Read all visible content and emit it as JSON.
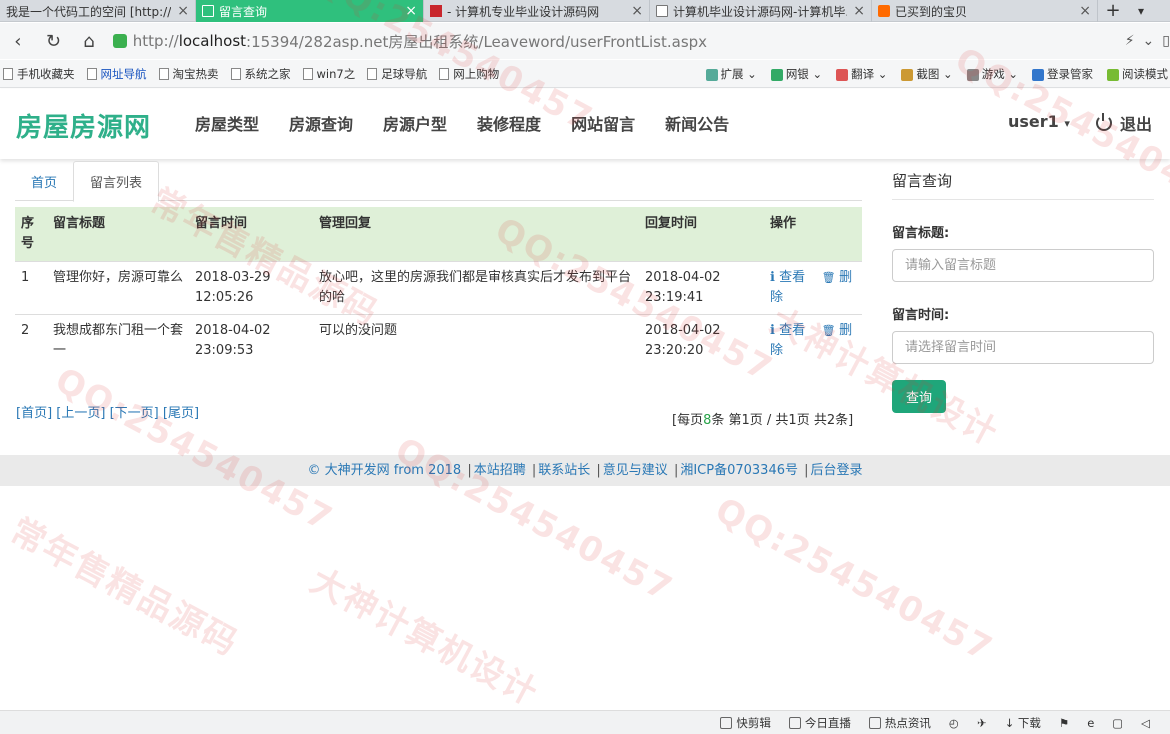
{
  "browser": {
    "tabs": [
      {
        "title": "我是一个代码工的空间 [http://...",
        "icon": "none",
        "active": false
      },
      {
        "title": "留言查询",
        "icon": "doc-icon",
        "active": true
      },
      {
        "title": "- 计算机专业毕业设计源码网",
        "icon": "red-icon",
        "active": false
      },
      {
        "title": "计算机毕业设计源码网-计算机毕...",
        "icon": "doc-icon",
        "active": false
      },
      {
        "title": "已买到的宝贝",
        "icon": "taobao-icon",
        "active": false
      }
    ],
    "new_tab": "+",
    "url_prefix": "http://",
    "url_host": "localhost",
    "url_rest": ":15394/282asp.net房屋出租系统/Leaveword/userFrontList.aspx"
  },
  "bookmarks": {
    "left": [
      "手机收藏夹",
      "网址导航",
      "淘宝热卖",
      "系统之家",
      "win7之",
      "足球导航",
      "网上购物"
    ],
    "right": [
      "扩展",
      "网银",
      "翻译",
      "截图",
      "游戏",
      "登录管家",
      "阅读模式"
    ]
  },
  "site": {
    "logo": "房屋房源网",
    "nav": [
      "房屋类型",
      "房源查询",
      "房源户型",
      "装修程度",
      "网站留言",
      "新闻公告"
    ],
    "user": "user1",
    "logout": "退出"
  },
  "content": {
    "tabs": [
      "首页",
      "留言列表"
    ],
    "table": {
      "headers": [
        "序号",
        "留言标题",
        "留言时间",
        "管理回复",
        "回复时间",
        "操作"
      ],
      "rows": [
        {
          "no": "1",
          "title": "管理你好，房源可靠么",
          "time": "2018-03-29 12:05:26",
          "reply": "放心吧，这里的房源我们都是审核真实后才发布到平台的哈",
          "reply_time": "2018-04-02 23:19:41",
          "view": "查看",
          "del": "删除"
        },
        {
          "no": "2",
          "title": "我想成都东门租一个套一",
          "time": "2018-04-02 23:09:53",
          "reply": "可以的没问题",
          "reply_time": "2018-04-02 23:20:20",
          "view": "查看",
          "del": "删除"
        }
      ]
    },
    "pager": {
      "first": "[首页]",
      "prev": "[上一页]",
      "next": "[下一页]",
      "last": "[尾页]",
      "info_pre": "[每页",
      "per_page": "8",
      "info_mid": "条 第",
      "page": "1",
      "info_post": "页 / 共1页 共2条]"
    }
  },
  "sidebar": {
    "title": "留言查询",
    "title_label": "留言标题:",
    "title_placeholder": "请输入留言标题",
    "time_label": "留言时间:",
    "time_placeholder": "请选择留言时间",
    "query_button": "查询"
  },
  "footer": {
    "copyright": "© 大神开发网 from 2018",
    "links": [
      "本站招聘",
      "联系站长",
      "意见与建议",
      "湘ICP备0703346号",
      "后台登录"
    ]
  },
  "statusbar": [
    "快剪辑",
    "今日直播",
    "热点资讯",
    "下载"
  ],
  "watermark": {
    "texts": [
      "QQ:254540457",
      "大神计算机设计",
      "常年售精品源码"
    ]
  }
}
